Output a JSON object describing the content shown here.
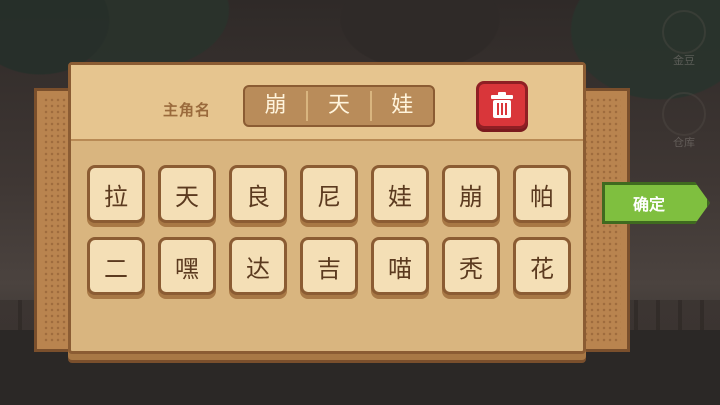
{
  "side_menu": {
    "item1_label": "金豆",
    "item2_label": "仓库"
  },
  "dialog": {
    "name_label": "主角名",
    "name_slots": [
      "崩",
      "天",
      "娃"
    ],
    "characters_row1": [
      "拉",
      "天",
      "良",
      "尼",
      "娃",
      "崩",
      "帕"
    ],
    "characters_row2": [
      "二",
      "嘿",
      "达",
      "吉",
      "喵",
      "秃",
      "花"
    ]
  },
  "confirm": {
    "label": "确定"
  },
  "icons": {
    "delete": "trash-icon"
  },
  "colors": {
    "panel": "#d9b57f",
    "tile": "#f4dfb6",
    "delete_button": "#d9363a",
    "confirm_button": "#7fbf3f"
  }
}
